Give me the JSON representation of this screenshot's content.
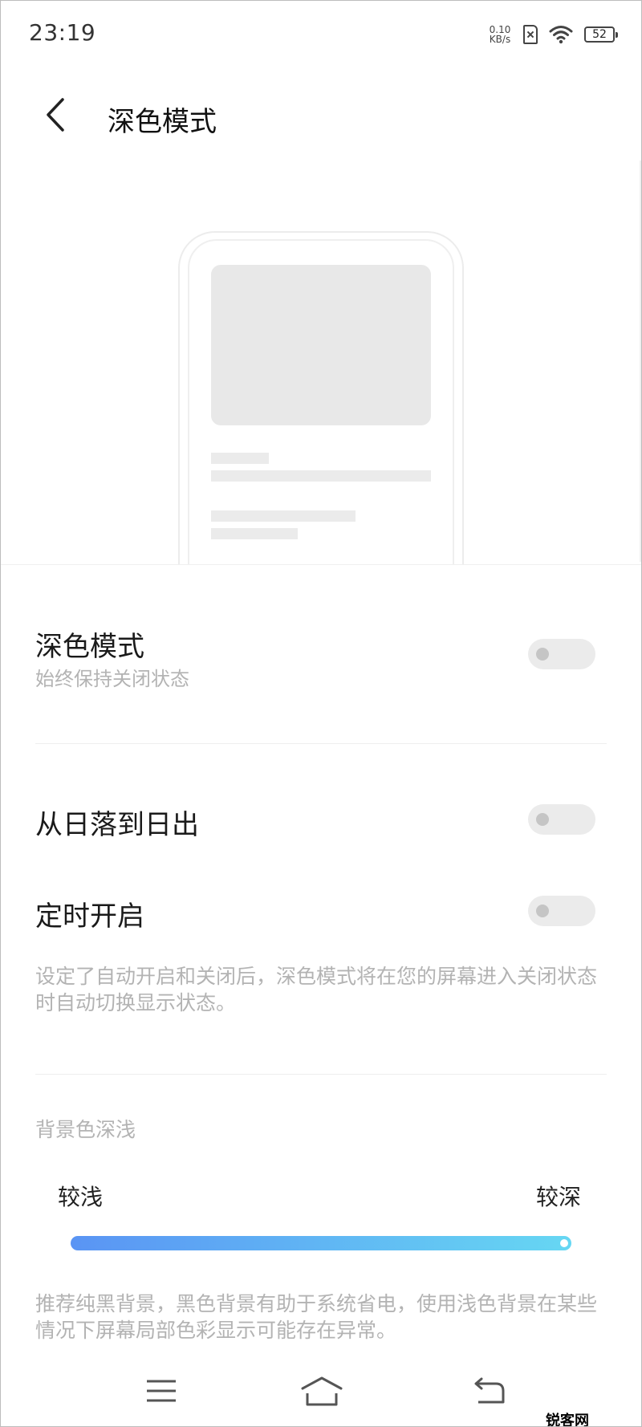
{
  "status_bar": {
    "time": "23:19",
    "net_speed_value": "0.10",
    "net_speed_unit": "KB/s",
    "battery_level": "52",
    "icons": [
      "sim-error-icon",
      "wifi-icon",
      "battery-icon"
    ]
  },
  "header": {
    "back_icon": "chevron-left-icon",
    "title": "深色模式"
  },
  "settings": {
    "dark_mode": {
      "title": "深色模式",
      "subtitle": "始终保持关闭状态",
      "enabled": false
    },
    "sunset_to_sunrise": {
      "title": "从日落到日出",
      "enabled": false
    },
    "scheduled": {
      "title": "定时开启",
      "enabled": false
    },
    "schedule_note": "设定了自动开启和关闭后，深色模式将在您的屏幕进入关闭状态时自动切换显示状态。"
  },
  "background_depth": {
    "section_label": "背景色深浅",
    "min_label": "较浅",
    "max_label": "较深",
    "level": 1.0,
    "gradient_colors": [
      "#5a94f4",
      "#66d7f3"
    ],
    "note": "推荐纯黑背景，黑色背景有助于系统省电，使用浅色背景在某些情况下屏幕局部色彩显示可能存在异常。"
  },
  "nav_bar": {
    "icons": [
      "menu-icon",
      "home-icon",
      "back-icon"
    ]
  },
  "watermark": {
    "text": "锐客网"
  }
}
